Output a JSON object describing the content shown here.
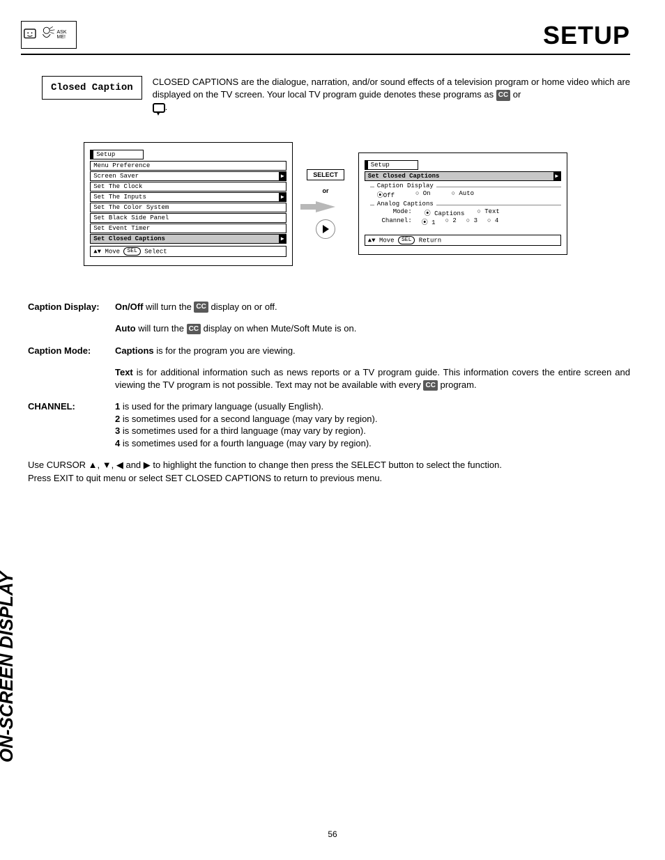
{
  "header": {
    "logo_text": "ASK ME!",
    "page_title": "SETUP"
  },
  "intro": {
    "box_label": "Closed Caption",
    "text_1": "CLOSED CAPTIONS are the dialogue, narration, and/or sound effects of a television program or home video which are displayed on the TV screen.  Your local TV program guide denotes these programs as ",
    "or": " or ",
    "period": "."
  },
  "cc_label": "CC",
  "screen_left": {
    "tab": "Setup",
    "items": [
      "Menu Preference",
      "Screen Saver",
      "Set The Clock",
      "Set The Inputs",
      "Set The Color System",
      "Set Black Side Panel",
      "Set Event Timer",
      "Set Closed Captions"
    ],
    "hint_move": "Move",
    "hint_select": "Select",
    "sel_btn": "SEL"
  },
  "middle": {
    "select": "SELECT",
    "or": "or"
  },
  "screen_right": {
    "tab": "Setup",
    "item_highlight": "Set Closed Captions",
    "grp1_title": "Caption Display",
    "grp1_opts": [
      "Off",
      "On",
      "Auto"
    ],
    "grp2_title": "Analog Captions",
    "mode_label": "Mode:",
    "mode_opts": [
      "Captions",
      "Text"
    ],
    "channel_label": "Channel:",
    "channel_opts": [
      "1",
      "2",
      "3",
      "4"
    ],
    "hint_move": "Move",
    "hint_return": "Return",
    "sel_btn": "SEL"
  },
  "definitions": {
    "caption_display": {
      "label": "Caption Display:",
      "onoff_lead": "On/Off",
      "onoff_text_a": " will turn the ",
      "onoff_text_b": " display on or off.",
      "auto_lead": "Auto",
      "auto_text_a": " will turn the ",
      "auto_text_b": " display on when Mute/Soft Mute is on."
    },
    "caption_mode": {
      "label": "Caption Mode:",
      "captions_lead": "Captions",
      "captions_text": " is for the program you are viewing.",
      "text_lead": "Text",
      "text_text_a": " is for additional information such as news reports or a TV program guide.  This information covers the entire screen and viewing the TV program is not possible.  Text may not be available with every ",
      "text_text_b": " program."
    },
    "channel": {
      "label": "CHANNEL:",
      "l1a": "1",
      "l1b": " is used for the primary language (usually English).",
      "l2a": "2",
      "l2b": " is sometimes used for a second language (may vary by region).",
      "l3a": "3",
      "l3b": " is sometimes used for a third language (may vary by region).",
      "l4a": "4",
      "l4b": " is sometimes used for a fourth language (may vary by region)."
    }
  },
  "footnotes": {
    "l1": "Use CURSOR ▲, ▼, ◀ and ▶ to highlight the function to change then press the SELECT button to select the function.",
    "l2": "Press EXIT to quit menu or select SET CLOSED CAPTIONS to return to previous menu."
  },
  "side_label": "ON-SCREEN DISPLAY",
  "page_number": "56"
}
